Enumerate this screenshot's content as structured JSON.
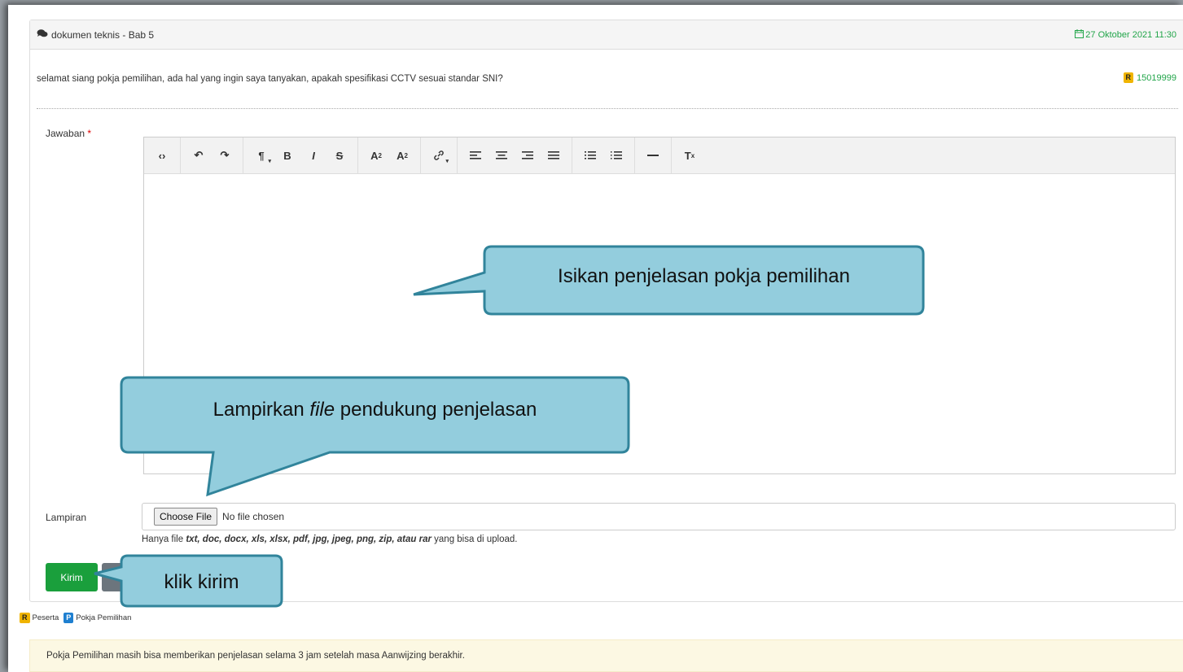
{
  "header": {
    "topic": "dokumen teknis - Bab 5",
    "date": "27 Oktober 2021 11:30"
  },
  "question": {
    "text": "selamat siang pokja pemilihan, ada hal yang ingin saya tanyakan, apakah spesifikasi CCTV sesuai standar SNI?",
    "badge": "R",
    "user_id": "15019999"
  },
  "form": {
    "answer_label": "Jawaban",
    "required_mark": "*",
    "attachment_label": "Lampiran",
    "choose_file_label": "Choose File",
    "no_file_text": "No file chosen",
    "hint_prefix": "Hanya file ",
    "hint_types": "txt, doc, docx, xls, xlsx, pdf, jpg, jpeg, png, zip, atau rar",
    "hint_suffix": " yang bisa di upload.",
    "submit_label": "Kirim"
  },
  "toolbar": {
    "icons": [
      "code-view-icon",
      "undo-icon",
      "redo-icon",
      "paragraph-icon",
      "bold-icon",
      "italic-icon",
      "strikethrough-icon",
      "superscript-icon",
      "subscript-icon",
      "link-icon",
      "align-left-icon",
      "align-center-icon",
      "align-right-icon",
      "align-justify-icon",
      "unordered-list-icon",
      "ordered-list-icon",
      "horizontal-rule-icon",
      "clear-format-icon"
    ]
  },
  "legend": {
    "r_badge": "R",
    "r_label": "Peserta",
    "p_badge": "P",
    "p_label": "Pokja Pemilihan"
  },
  "notice": "Pokja Pemilihan masih bisa memberikan penjelasan selama 3 jam setelah masa Aanwijzing berakhir.",
  "callouts": {
    "editor": "Isikan penjelasan pokja pemilihan",
    "attach_pre": "Lampirkan ",
    "attach_italic": "file",
    "attach_post": " pendukung penjelasan",
    "submit": "klik kirim"
  },
  "colors": {
    "green": "#1a9f3c",
    "callout_fill": "#93cddd",
    "callout_border": "#31849b",
    "notice_bg": "#fcf8e3"
  }
}
